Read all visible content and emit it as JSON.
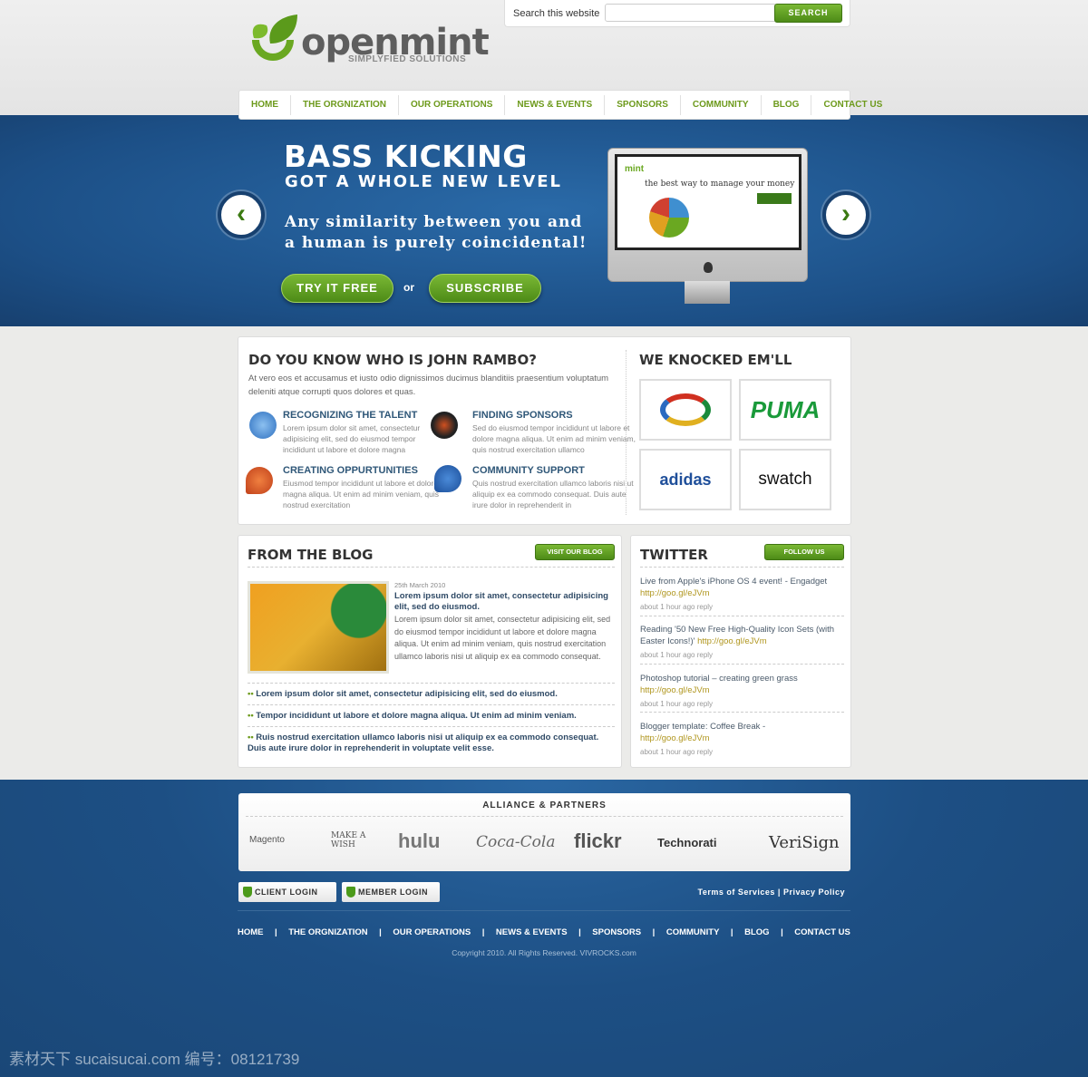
{
  "logo": {
    "name": "openmint",
    "tagline": "SIMPLYFIED SOLUTIONS"
  },
  "search": {
    "label": "Search this website",
    "value": "",
    "button": "SEARCH"
  },
  "nav": [
    "HOME",
    "THE ORGNIZATION",
    "OUR OPERATIONS",
    "NEWS & EVENTS",
    "SPONSORS",
    "COMMUNITY",
    "BLOG",
    "CONTACT US"
  ],
  "hero": {
    "title": "BASS KICKING",
    "subtitle": "GOT A WHOLE NEW LEVEL",
    "text": "Any similarity between you and a human is purely coincidental!",
    "try_button": "TRY IT FREE",
    "or": "or",
    "subscribe_button": "SUBSCRIBE",
    "screen_brand": "mint",
    "screen_headline": "the best way to manage your money"
  },
  "about": {
    "title": "DO YOU KNOW WHO IS JOHN RAMBO?",
    "intro": "At vero eos et accusamus et iusto odio dignissimos ducimus blanditiis praesentium voluptatum deleniti atque corrupti quos dolores et quas.",
    "features": [
      {
        "title": "RECOGNIZING THE TALENT",
        "text": "Lorem ipsum dolor sit amet, consectetur adipisicing elit, sed do eiusmod tempor incididunt ut labore et dolore magna",
        "icon": "users-icon"
      },
      {
        "title": "FINDING SPONSORS",
        "text": "Sed do eiusmod tempor incididunt ut labore et dolore magna aliqua. Ut enim ad minim veniam, quis nostrud exercitation ullamco",
        "icon": "binoculars-icon"
      },
      {
        "title": "CREATING OPPURTUNITIES",
        "text": "Eiusmod tempor incididunt ut labore et dolore magna aliqua. Ut enim ad minim veniam, quis nostrud exercitation",
        "icon": "heart-plus-icon"
      },
      {
        "title": "COMMUNITY SUPPORT",
        "text": "Quis nostrud exercitation ullamco laboris nisi ut aliquip ex ea commodo consequat. Duis aute irure dolor in reprehenderit in",
        "icon": "speech-bubble-icon"
      }
    ]
  },
  "sponsors": {
    "title": "WE KNOCKED EM'LL",
    "logos": [
      "",
      "PUMA",
      "adidas",
      "swatch"
    ]
  },
  "blog": {
    "title": "FROM THE BLOG",
    "button": "VISIT OUR BLOG",
    "date": "25th March 2010",
    "post_title": "Lorem ipsum dolor sit amet, consectetur adipisicing elit, sed do eiusmod.",
    "post_text": "Lorem ipsum dolor sit amet, consectetur adipisicing elit, sed do eiusmod tempor incididunt ut labore et dolore magna aliqua. Ut enim ad minim veniam, quis nostrud exercitation ullamco laboris nisi ut aliquip ex ea commodo consequat.",
    "links": [
      "Lorem ipsum dolor sit amet, consectetur adipisicing elit, sed do eiusmod.",
      "Tempor incididunt ut labore et dolore magna aliqua. Ut enim ad minim veniam.",
      "Ruis nostrud exercitation ullamco laboris nisi ut aliquip ex ea commodo consequat. Duis aute irure dolor in reprehenderit in voluptate velit esse."
    ]
  },
  "twitter": {
    "title": "TWITTER",
    "button": "FOLLOW US",
    "tweets": [
      {
        "text": "Live from Apple's iPhone OS 4 event! - Engadget",
        "link": "http://goo.gl/eJVm",
        "meta": "about 1 hour ago reply"
      },
      {
        "text": "Reading '50 New Free High-Quality Icon Sets (with Easter Icons!)'",
        "link": "http://goo.gl/eJVm",
        "meta": "about 1 hour ago reply"
      },
      {
        "text": "Photoshop tutorial – creating green grass",
        "link": "http://goo.gl/eJVm",
        "meta": "about 1 hour ago reply"
      },
      {
        "text": "Blogger template: Coffee Break -",
        "link": "http://goo.gl/eJVm",
        "meta": "about 1 hour ago reply"
      }
    ]
  },
  "partners": {
    "title": "ALLIANCE & PARTNERS",
    "logos": [
      "Magento",
      "MAKE A WISH",
      "hulu",
      "Coca-Cola",
      "flickr",
      "Technorati",
      "VeriSign"
    ]
  },
  "footer": {
    "client_login": "CLIENT LOGIN",
    "member_login": "MEMBER LOGIN",
    "terms": "Terms of Services",
    "sep": "|",
    "privacy": "Privacy Policy",
    "nav": [
      "HOME",
      "THE ORGNIZATION",
      "OUR OPERATIONS",
      "NEWS & EVENTS",
      "SPONSORS",
      "COMMUNITY",
      "BLOG",
      "CONTACT US"
    ],
    "copyright": "Copyright 2010. All Rights Reserved. VIVROCKS.com"
  },
  "watermark": "素材天下 sucaisucai.com  编号：08121739",
  "colors": {
    "green": "#6d9a1c",
    "blue": "#1d4f84"
  }
}
